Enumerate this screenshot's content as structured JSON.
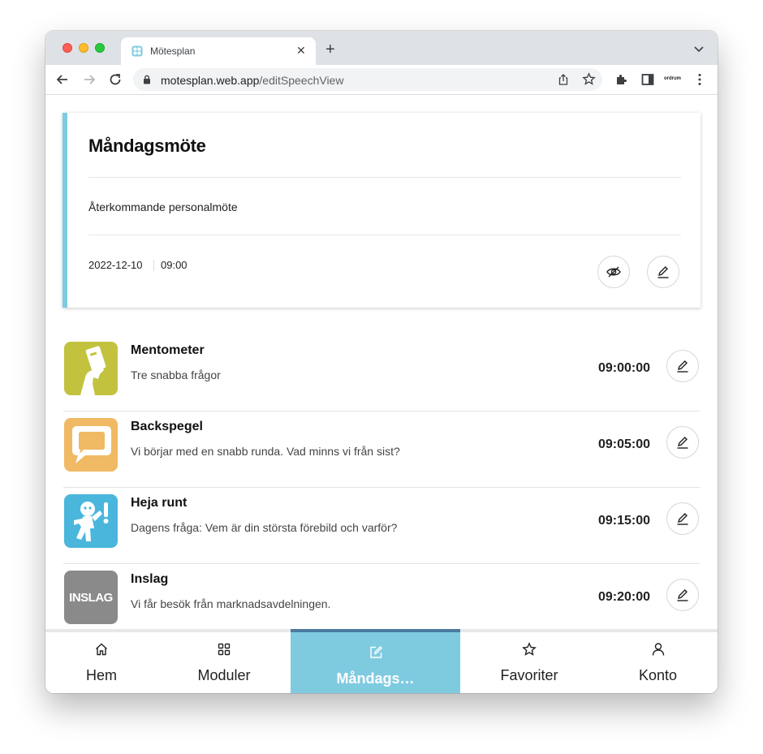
{
  "browser": {
    "tab_title": "Mötesplan",
    "url_host": "motesplan.web.app",
    "url_path": "/editSpeechView",
    "extension_label": "ordrum"
  },
  "meeting": {
    "title": "Måndagsmöte",
    "description": "Återkommande personalmöte",
    "date": "2022-12-10",
    "time": "09:00"
  },
  "agenda": [
    {
      "title": "Mentometer",
      "subtitle": "Tre snabba frågor",
      "time": "09:00:00",
      "icon": "hand-holding-phone-icon",
      "color": "#c3c23f"
    },
    {
      "title": "Backspegel",
      "subtitle": "Vi börjar med en snabb runda. Vad minns vi från sist?",
      "time": "09:05:00",
      "icon": "speech-bubble-icon",
      "color": "#f0b964"
    },
    {
      "title": "Heja runt",
      "subtitle": "Dagens fråga: Vem är din största förebild och varför?",
      "time": "09:15:00",
      "icon": "cheering-figure-icon",
      "color": "#4ab6dc"
    },
    {
      "title": "Inslag",
      "subtitle": "Vi får besök från marknadsavdelningen.",
      "time": "09:20:00",
      "icon": "inslag-label-icon",
      "icon_text": "INSLAG",
      "color": "#8a8a8a"
    }
  ],
  "nav": [
    {
      "label": "Hem",
      "icon": "home-icon"
    },
    {
      "label": "Moduler",
      "icon": "grid-icon"
    },
    {
      "label": "Måndags…",
      "icon": "edit-icon",
      "active": true
    },
    {
      "label": "Favoriter",
      "icon": "star-icon"
    },
    {
      "label": "Konto",
      "icon": "user-icon"
    }
  ],
  "colors": {
    "accent": "#7ecbe0",
    "active_nav_border": "#4a7aa0"
  }
}
